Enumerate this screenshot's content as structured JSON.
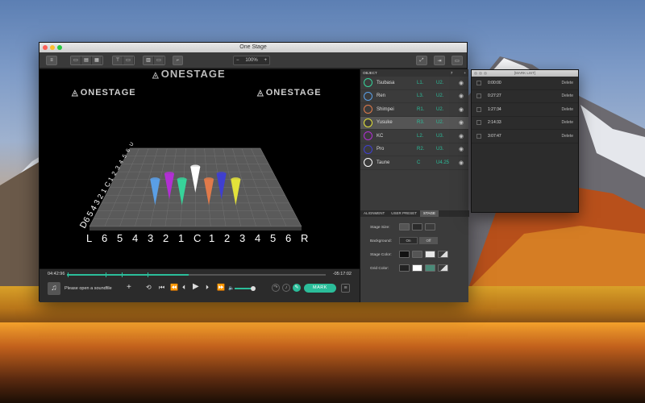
{
  "window": {
    "title": "One Stage"
  },
  "toolbar": {
    "zoom_minus": "−",
    "zoom_value": "100%",
    "zoom_plus": "+"
  },
  "stage": {
    "logo_top": "ONESTAGE",
    "logo_left": "ONESTAGE",
    "logo_right": "ONESTAGE",
    "front_labels": [
      "L",
      "6",
      "5",
      "4",
      "3",
      "2",
      "1",
      "C",
      "1",
      "2",
      "3",
      "4",
      "5",
      "6",
      "R"
    ],
    "depth_labels": [
      "D",
      "6",
      "5",
      "4",
      "3",
      "2",
      "1",
      "C",
      "1",
      "2",
      "3",
      "4",
      "5",
      "6",
      "U"
    ]
  },
  "transport": {
    "elapsed": "04:42:96",
    "remaining": "-05:17:02",
    "song_placeholder": "Please open a soundfile",
    "add_label": "+",
    "mark_label": "MARK",
    "progress_fraction": 0.47
  },
  "panel": {
    "header": "OBJECT",
    "count": "7",
    "add": "+",
    "objects": [
      {
        "name": "Tsubasa",
        "pos1": "L1.",
        "pos2": "U2.",
        "color": "#37d39a"
      },
      {
        "name": "Ren",
        "pos1": "L3.",
        "pos2": "U2.",
        "color": "#5a9fe6"
      },
      {
        "name": "Shimpei",
        "pos1": "R1.",
        "pos2": "U2.",
        "color": "#e07a4a"
      },
      {
        "name": "Yusuke",
        "pos1": "R3.",
        "pos2": "U2.",
        "color": "#e3e23a"
      },
      {
        "name": "KC",
        "pos1": "L2.",
        "pos2": "U3.",
        "color": "#b22fd4"
      },
      {
        "name": "Pro",
        "pos1": "R2.",
        "pos2": "U3.",
        "color": "#3f3fd0"
      },
      {
        "name": "Taune",
        "pos1": "C",
        "pos2": "U4.25",
        "color": "#ffffff"
      }
    ],
    "tabs": [
      "ALIGNMENT",
      "USER PRESET",
      "STAGE"
    ],
    "stage_size_label": "Stage Size:",
    "background_label": "Background:",
    "bg_on": "On",
    "bg_off": "Off",
    "stage_color_label": "Stage Color:",
    "grid_color_label": "Grid Color:"
  },
  "mark_list": {
    "title": "[MARK LIST]",
    "delete_label": "Delete",
    "marks": [
      "0:00:00",
      "0:27:27",
      "1:27:34",
      "2:14:33",
      "3:07:47"
    ]
  },
  "colors": {
    "accent": "#2bbd9a"
  }
}
